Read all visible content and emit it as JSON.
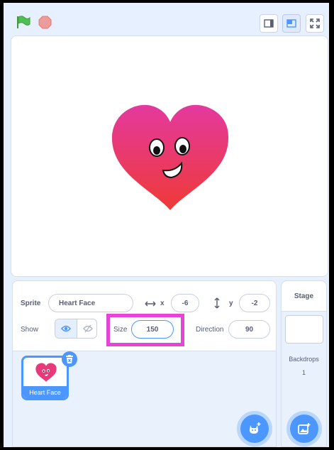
{
  "toolbar": {
    "icons": [
      "green-flag-icon",
      "stop-icon",
      "small-stage-icon",
      "normal-stage-icon",
      "fullscreen-icon"
    ]
  },
  "sprite_info": {
    "sprite_label": "Sprite",
    "sprite_name": "Heart Face",
    "x_label": "x",
    "x_value": "-6",
    "y_label": "y",
    "y_value": "-2",
    "show_label": "Show",
    "size_label": "Size",
    "size_value": "150",
    "direction_label": "Direction",
    "direction_value": "90"
  },
  "sprites": [
    {
      "name": "Heart Face",
      "selected": true
    }
  ],
  "stage_panel": {
    "title": "Stage",
    "backdrops_label": "Backdrops",
    "backdrops_count": "1"
  },
  "colors": {
    "accent": "#4c97ff",
    "highlight": "#e545d6",
    "heart_top": "#e4399f",
    "heart_bottom": "#ee3a36"
  }
}
